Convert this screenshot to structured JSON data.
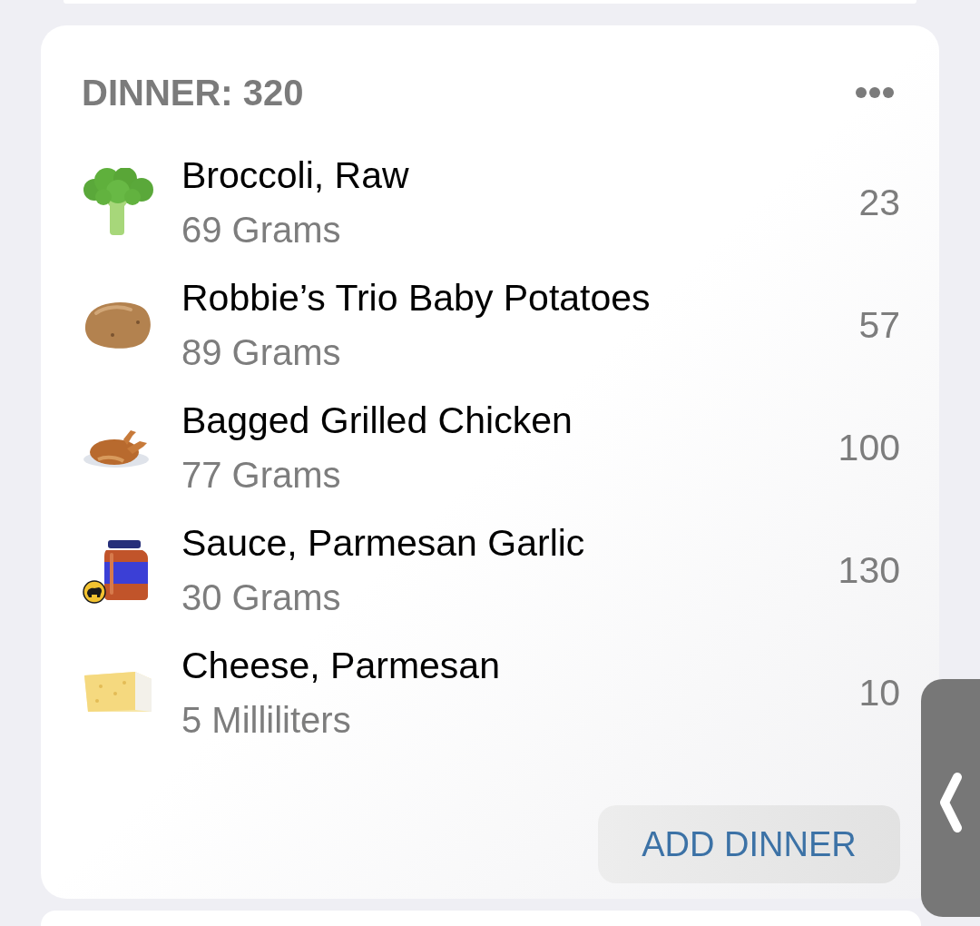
{
  "card": {
    "title": "DINNER: 320",
    "items": [
      {
        "kind": "broccoli",
        "name": "Broccoli, Raw",
        "amount": "69 Grams",
        "calories": "23",
        "badge": false
      },
      {
        "kind": "potato",
        "name": "Robbie’s Trio Baby Potatoes",
        "amount": "89 Grams",
        "calories": "57",
        "badge": false
      },
      {
        "kind": "chicken",
        "name": "Bagged Grilled Chicken",
        "amount": "77 Grams",
        "calories": "100",
        "badge": false
      },
      {
        "kind": "jar",
        "name": "Sauce, Parmesan Garlic",
        "amount": "30 Grams",
        "calories": "130",
        "badge": true
      },
      {
        "kind": "cheese",
        "name": "Cheese, Parmesan",
        "amount": "5 Milliliters",
        "calories": "10",
        "badge": false
      }
    ],
    "button": "ADD DINNER"
  }
}
